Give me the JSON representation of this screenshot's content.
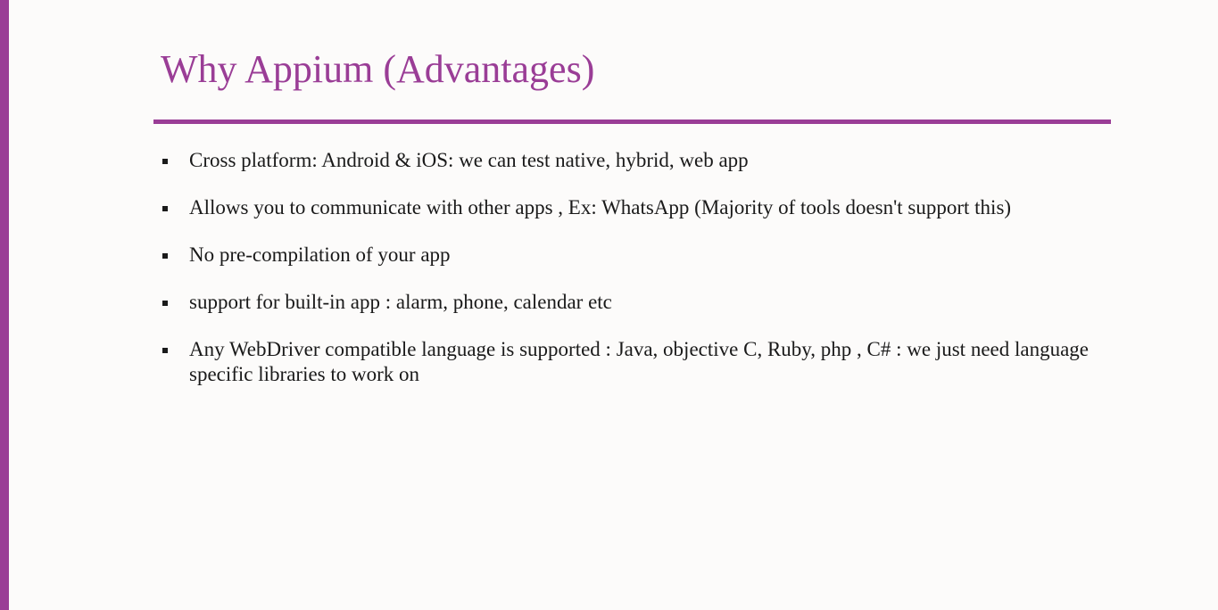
{
  "slide": {
    "title": "Why Appium (Advantages)",
    "accent_color": "#9a3d96",
    "bullets": [
      "Cross platform: Android & iOS: we can test native, hybrid, web app",
      "Allows you to communicate with other apps , Ex: WhatsApp (Majority of tools doesn't support this)",
      "No pre-compilation of your app",
      "support for built-in app : alarm, phone, calendar etc",
      "Any WebDriver compatible language is supported : Java, objective C, Ruby, php , C# : we just need language specific libraries to work on"
    ]
  }
}
